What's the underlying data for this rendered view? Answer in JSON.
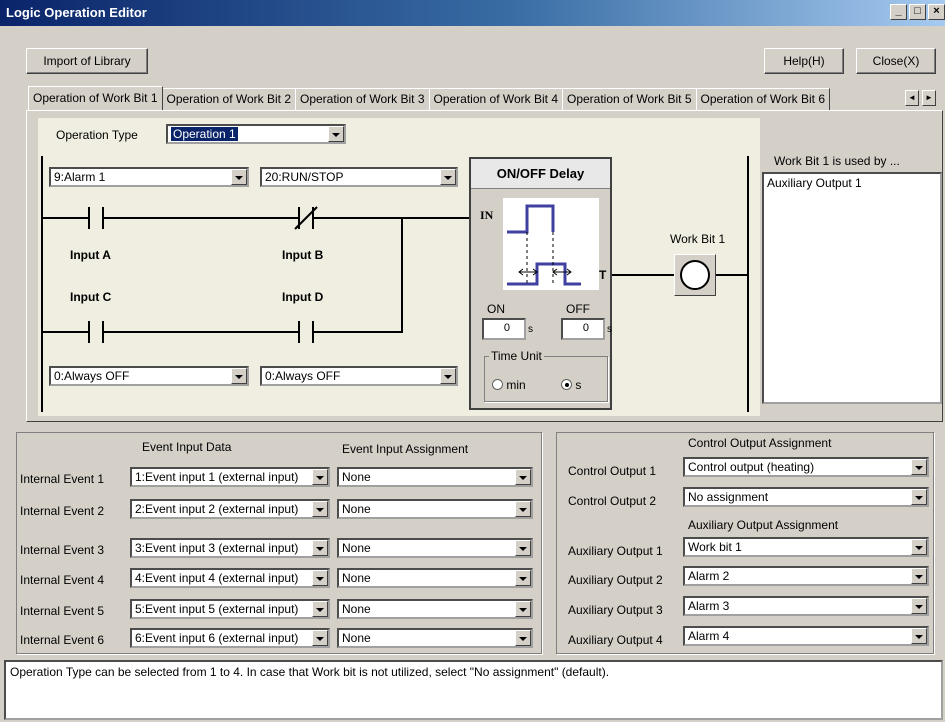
{
  "window": {
    "title": "Logic Operation Editor",
    "minimize": "_",
    "maximize": "□",
    "close": "×"
  },
  "toolbar": {
    "import_label": "Import of Library",
    "help_label": "Help(H)",
    "close_label": "Close(X)"
  },
  "tabs": [
    "Operation of Work Bit 1",
    "Operation of Work Bit 2",
    "Operation of Work Bit 3",
    "Operation of Work Bit 4",
    "Operation of Work Bit 5",
    "Operation of Work Bit 6"
  ],
  "operation": {
    "type_label": "Operation Type",
    "type_value": "Operation 1"
  },
  "ladder": {
    "input_a": {
      "label": "Input A",
      "value": "9:Alarm 1"
    },
    "input_b": {
      "label": "Input B",
      "value": "20:RUN/STOP"
    },
    "input_c": {
      "label": "Input C",
      "value": "0:Always OFF"
    },
    "input_d": {
      "label": "Input D",
      "value": "0:Always OFF"
    },
    "work_bit_label": "Work Bit 1"
  },
  "delay": {
    "title": "ON/OFF Delay",
    "in_label": "IN",
    "out_label": "OUT",
    "on_label": "ON",
    "off_label": "OFF",
    "on_value": "0",
    "off_value": "0",
    "unit_suffix": "s",
    "time_unit_label": "Time Unit",
    "min_label": "min",
    "s_label": "s",
    "selected_unit": "s"
  },
  "used_by": {
    "label": "Work Bit 1 is used by ...",
    "items": [
      "Auxiliary Output 1"
    ]
  },
  "events": {
    "data_header": "Event Input Data",
    "assign_header": "Event Input Assignment",
    "rows": [
      {
        "label": "Internal Event 1",
        "data": "1:Event input 1 (external input)",
        "assign": "None"
      },
      {
        "label": "Internal Event 2",
        "data": "2:Event input 2 (external input)",
        "assign": "None"
      },
      {
        "label": "Internal Event 3",
        "data": "3:Event input 3 (external input)",
        "assign": "None"
      },
      {
        "label": "Internal Event 4",
        "data": "4:Event input 4 (external input)",
        "assign": "None"
      },
      {
        "label": "Internal Event 5",
        "data": "5:Event input 5 (external input)",
        "assign": "None"
      },
      {
        "label": "Internal Event 6",
        "data": "6:Event input 6 (external input)",
        "assign": "None"
      }
    ]
  },
  "control": {
    "header": "Control Output Assignment",
    "rows": [
      {
        "label": "Control Output 1",
        "value": "Control output (heating)"
      },
      {
        "label": "Control Output 2",
        "value": "No assignment"
      }
    ]
  },
  "auxiliary": {
    "header": "Auxiliary Output Assignment",
    "rows": [
      {
        "label": "Auxiliary Output 1",
        "value": "Work bit 1"
      },
      {
        "label": "Auxiliary Output 2",
        "value": "Alarm 2"
      },
      {
        "label": "Auxiliary Output 3",
        "value": "Alarm 3"
      },
      {
        "label": "Auxiliary Output 4",
        "value": "Alarm 4"
      }
    ]
  },
  "status": {
    "text": "Operation Type can be selected from 1 to 4. In case that Work bit is not utilized, select \"No assignment\" (default)."
  }
}
